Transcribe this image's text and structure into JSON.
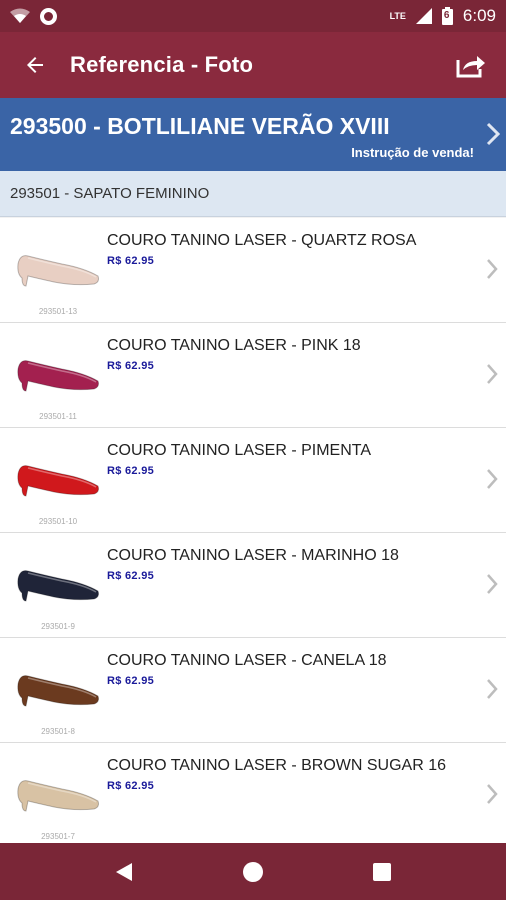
{
  "status_bar": {
    "network": "LTE",
    "battery": "6",
    "time": "6:09"
  },
  "app_bar": {
    "title": "Referencia - Foto"
  },
  "collection": {
    "title": "293500 - BOTLILIANE VERÃO XVIII",
    "subtitle": "Instrução de venda!"
  },
  "subheader": {
    "label": "293501 - SAPATO FEMININO"
  },
  "items": [
    {
      "name": "COURO TANINO LASER - QUARTZ ROSA",
      "price": "R$  62.95",
      "code": "293501-13",
      "color": "#e8cfc3"
    },
    {
      "name": "COURO TANINO LASER - PINK 18",
      "price": "R$  62.95",
      "code": "293501-11",
      "color": "#a3204f"
    },
    {
      "name": "COURO TANINO LASER - PIMENTA",
      "price": "R$  62.95",
      "code": "293501-10",
      "color": "#d0181c"
    },
    {
      "name": "COURO TANINO LASER - MARINHO 18",
      "price": "R$  62.95",
      "code": "293501-9",
      "color": "#1f2438"
    },
    {
      "name": "COURO TANINO LASER - CANELA 18",
      "price": "R$  62.95",
      "code": "293501-8",
      "color": "#6b3a1f"
    },
    {
      "name": "COURO TANINO LASER - BROWN SUGAR 16",
      "price": "R$  62.95",
      "code": "293501-7",
      "color": "#d8c2a4"
    }
  ],
  "colors": {
    "app_bar": "#8a2a3e",
    "status_bar": "#7a2637",
    "collection_bar": "#3a64a6",
    "subheader": "#dde7f2",
    "price": "#1a1a9a"
  }
}
